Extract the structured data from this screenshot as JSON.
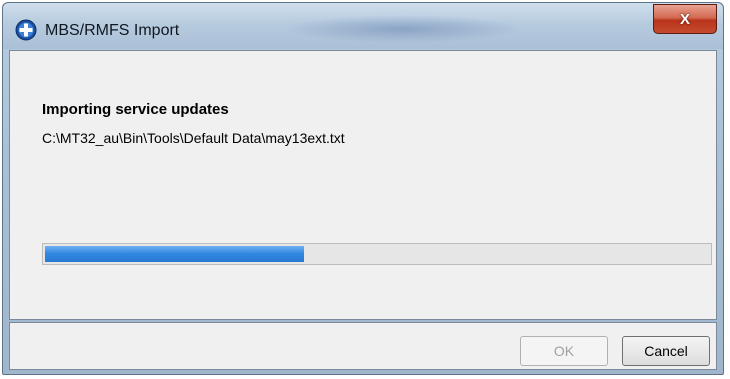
{
  "window": {
    "title": "MBS/RMFS Import",
    "close_label": "X",
    "icon": "plus-circle-icon"
  },
  "main": {
    "heading": "Importing service updates",
    "file_path": "C:\\MT32_au\\Bin\\Tools\\Default Data\\may13ext.txt",
    "progress_fraction": 0.39
  },
  "buttons": {
    "ok_label": "OK",
    "cancel_label": "Cancel"
  },
  "colors": {
    "progress": "#2f86e0",
    "close": "#c64a2e"
  }
}
